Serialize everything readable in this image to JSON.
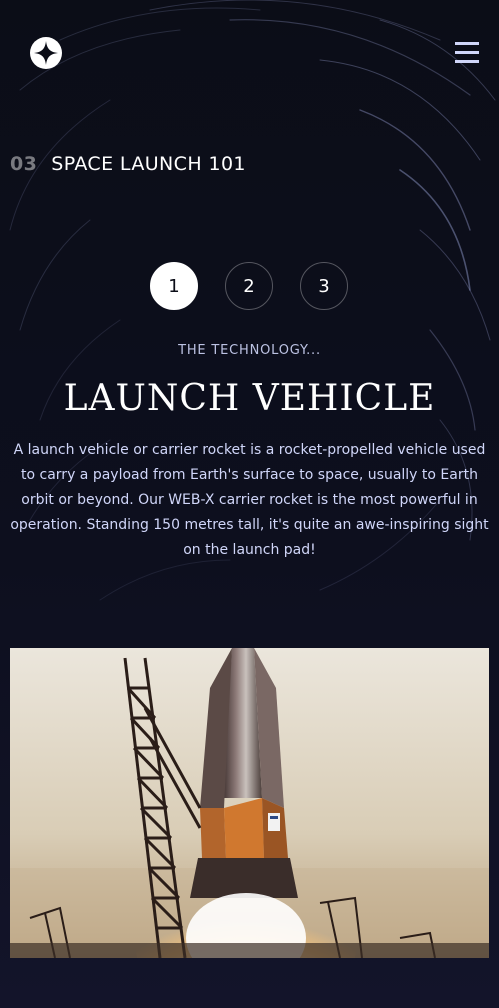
{
  "header": {
    "logo_icon": "four-point-star-icon",
    "menu_icon": "hamburger-menu-icon"
  },
  "eyebrow": {
    "number": "03",
    "text": "SPACE LAUNCH 101"
  },
  "steps": [
    "1",
    "2",
    "3"
  ],
  "active_step": "1",
  "technology": {
    "subtitle": "THE TECHNOLOGY...",
    "title": "LAUNCH VEHICLE",
    "description": "A launch vehicle or carrier rocket is a rocket-propelled vehicle used to carry a payload from Earth's surface to space, usually to Earth orbit or beyond. Our WEB-X carrier rocket is the most powerful in operation. Standing 150 metres tall, it's quite an awe-inspiring sight on the launch pad!"
  },
  "colors": {
    "background": "#0b0d17",
    "accent": "#d0d6f9",
    "white": "#ffffff"
  }
}
